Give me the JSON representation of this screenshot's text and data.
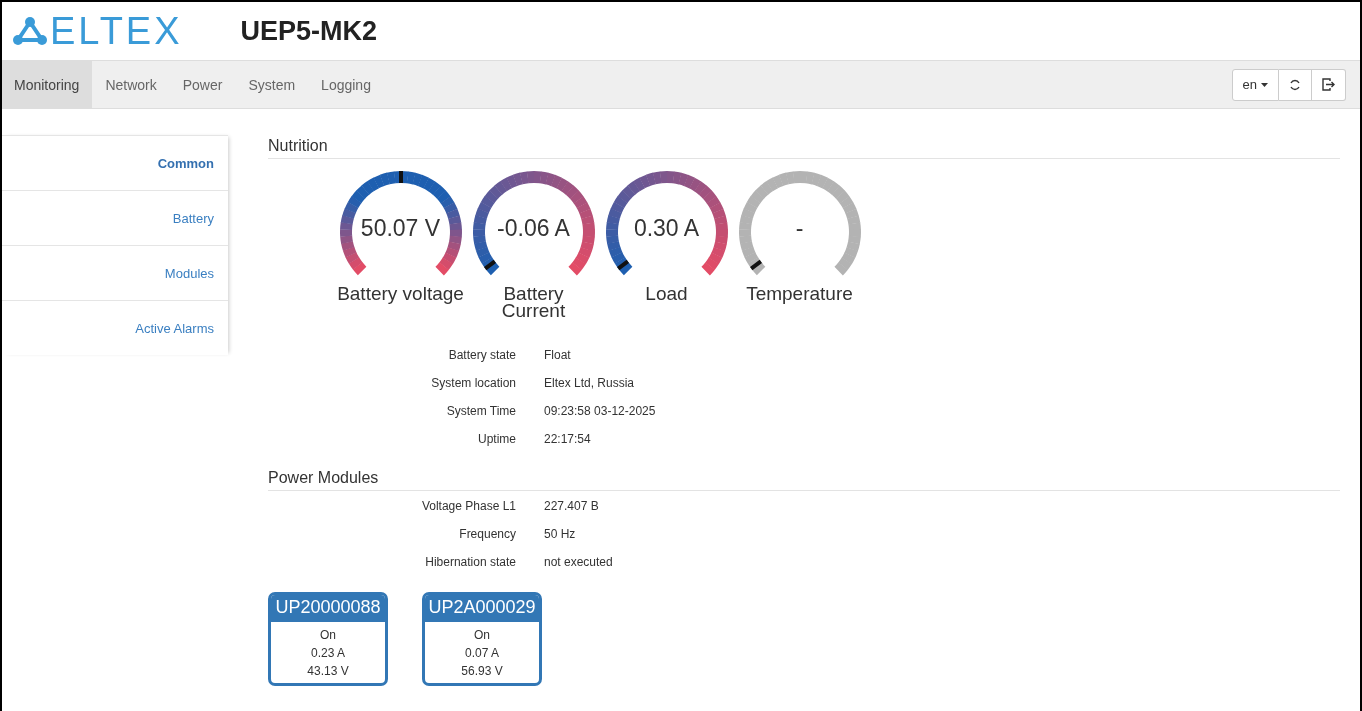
{
  "header": {
    "logo": "ELTEX",
    "title": "UEP5-MK2"
  },
  "nav": {
    "tabs": [
      {
        "label": "Monitoring",
        "selected": true
      },
      {
        "label": "Network",
        "selected": false
      },
      {
        "label": "Power",
        "selected": false
      },
      {
        "label": "System",
        "selected": false
      },
      {
        "label": "Logging",
        "selected": false
      }
    ],
    "language": "en"
  },
  "sidebar": {
    "items": [
      {
        "label": "Common",
        "selected": true
      },
      {
        "label": "Battery",
        "selected": false
      },
      {
        "label": "Modules",
        "selected": false
      },
      {
        "label": "Active Alarms",
        "selected": false
      }
    ]
  },
  "nutrition": {
    "title": "Nutrition",
    "gauges": [
      {
        "value": "50.07 V",
        "label": "Battery voltage",
        "kind": "vertical"
      },
      {
        "value": "-0.06 A",
        "label": "Battery Current",
        "kind": "horizontal"
      },
      {
        "value": "0.30 A",
        "label": "Load",
        "kind": "horizontal"
      },
      {
        "value": "-",
        "label": "Temperature",
        "kind": "grey"
      }
    ],
    "info": [
      {
        "label": "Battery state",
        "value": "Float"
      },
      {
        "label": "System location",
        "value": "Eltex Ltd, Russia"
      },
      {
        "label": "System Time",
        "value": "09:23:58 03-12-2025"
      },
      {
        "label": "Uptime",
        "value": "22:17:54"
      }
    ]
  },
  "power_modules": {
    "title": "Power Modules",
    "info": [
      {
        "label": "Voltage Phase L1",
        "value": "227.407 B"
      },
      {
        "label": "Frequency",
        "value": "50 Hz"
      },
      {
        "label": "Hibernation state",
        "value": "not executed"
      }
    ],
    "modules": [
      {
        "name": "UP20000088",
        "state": "On",
        "current": "0.23 A",
        "voltage": "43.13 V"
      },
      {
        "name": "UP2A000029",
        "state": "On",
        "current": "0.07 A",
        "voltage": "56.93 V"
      }
    ]
  }
}
